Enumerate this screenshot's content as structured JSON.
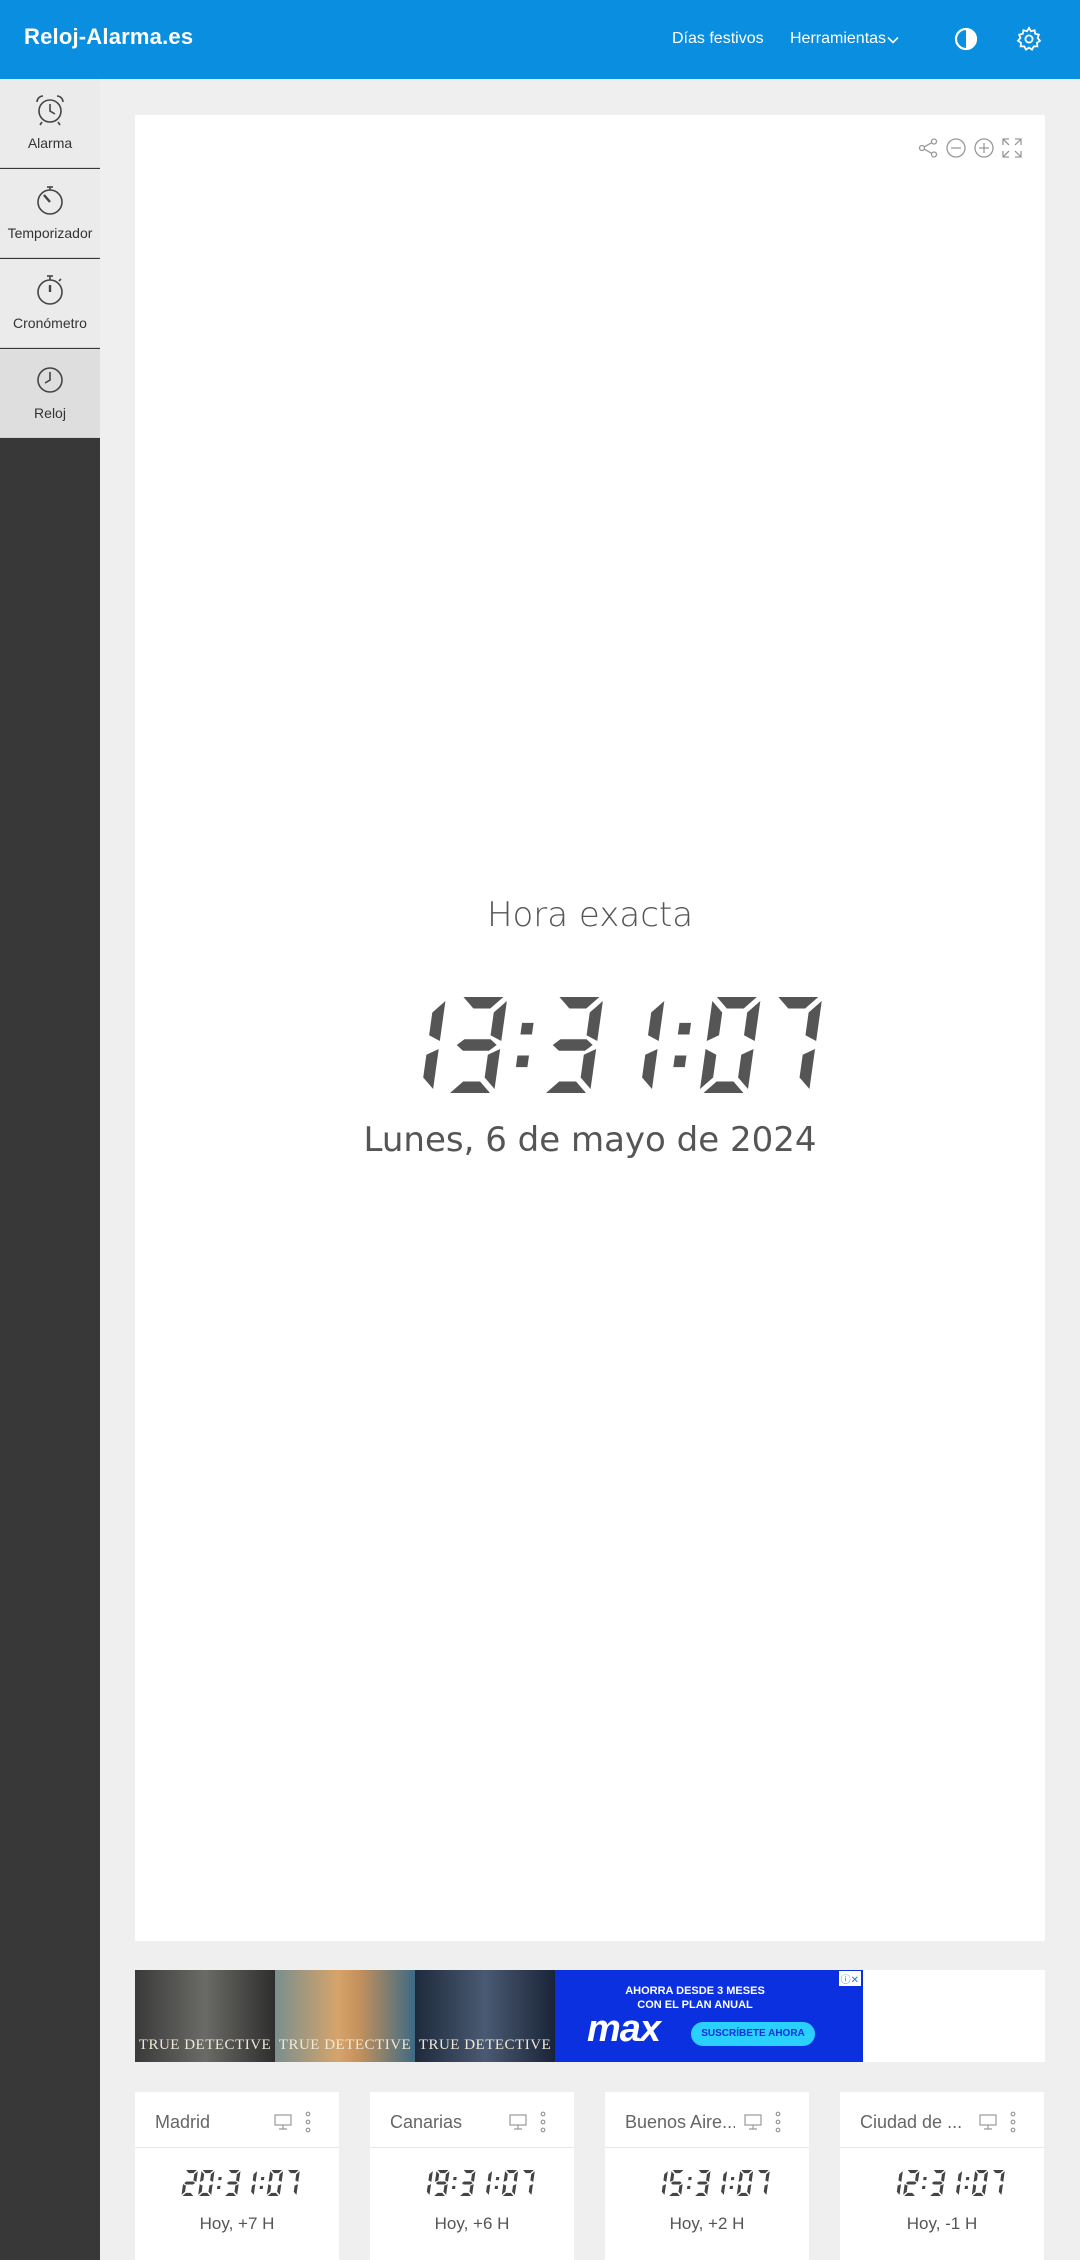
{
  "header": {
    "logo": "Reloj-Alarma.es",
    "nav": {
      "holidays": "Días festivos",
      "tools": "Herramientas"
    },
    "icons": [
      "chevron-down-icon",
      "contrast-icon",
      "gear-icon"
    ],
    "color": "#0a8ee0"
  },
  "sidebar": {
    "items": [
      {
        "label": "Alarma",
        "icon": "alarm-clock-icon",
        "active": false
      },
      {
        "label": "Temporizador",
        "icon": "timer-icon",
        "active": false
      },
      {
        "label": "Cronómetro",
        "icon": "stopwatch-icon",
        "active": false
      },
      {
        "label": "Reloj",
        "icon": "clock-icon",
        "active": true
      }
    ]
  },
  "clock": {
    "title": "Hora exacta",
    "time": "13:31:07",
    "date": "Lunes, 6 de mayo de 2024",
    "tools": [
      "share-icon",
      "zoom-out-icon",
      "zoom-in-icon",
      "fullscreen-icon"
    ]
  },
  "ad": {
    "tiles": [
      "TRUE DETECTIVE",
      "TRUE DETECTIVE",
      "TRUE DETECTIVE"
    ],
    "promo_line1": "AHORRA DESDE 3 MESES",
    "promo_line2": "CON EL PLAN ANUAL",
    "brand": "max",
    "cta": "SUSCRÍBETE AHORA"
  },
  "cities": [
    {
      "name": "Madrid",
      "time": "20:31:07",
      "diff": "Hoy, +7 H"
    },
    {
      "name": "Canarias",
      "time": "19:31:07",
      "diff": "Hoy, +6 H"
    },
    {
      "name": "Buenos Aire...",
      "time": "15:31:07",
      "diff": "Hoy, +2 H"
    },
    {
      "name": "Ciudad de ...",
      "time": "12:31:07",
      "diff": "Hoy, -1 H"
    }
  ]
}
